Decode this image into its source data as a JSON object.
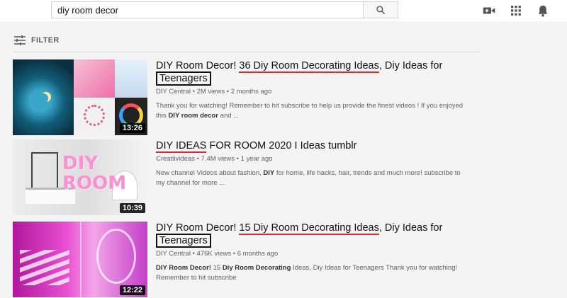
{
  "search": {
    "query": "diy room decor",
    "icon": "search-icon"
  },
  "header_icons": [
    "video-camera-icon",
    "apps-grid-icon",
    "bell-icon"
  ],
  "filter": {
    "label": "FILTER",
    "icon": "filter-sliders-icon"
  },
  "results": [
    {
      "title_parts": [
        "DIY Room Decor! ",
        "36 Diy Room Decorating Ideas",
        ", Diy Ideas for ",
        "Teenagers"
      ],
      "channel": "DIY Central",
      "views": "2M views",
      "age": "2 months ago",
      "description_parts": [
        "Thank you for watching! Remember to hit subscribe to help us provide the finest videos ! If you enjoyed this ",
        "DIY room decor",
        " and ..."
      ],
      "duration": "13:26"
    },
    {
      "title_parts": [
        "DIY IDEAS",
        " FOR ROOM 2020 I Ideas tumblr"
      ],
      "channel": "Creatiivideas",
      "views": "7.4M views",
      "age": "1 year ago",
      "description_parts": [
        "New channel Videos about fashion, ",
        "DIY",
        " for home, life hacks, hair, trends and much more! subscribe to my channel for more ..."
      ],
      "duration": "10:39",
      "thumb_text_1": "DIY",
      "thumb_text_2": "ROOM"
    },
    {
      "title_parts": [
        "DIY Room Decor! ",
        "15 Diy Room Decorating Ideas",
        ", Diy Ideas for ",
        "Teenagers"
      ],
      "channel": "DIY Central",
      "views": "476K views",
      "age": "6 months ago",
      "description_parts": [
        "DIY Room Decor!",
        " 15 ",
        "Diy Room Decorating",
        " Ideas, Diy Ideas for Teenagers Thank you for watching! Remember to hit subscribe"
      ],
      "duration": "12:22"
    }
  ],
  "colors": {
    "underline": "#d62b2b",
    "box": "#111111",
    "meta_text": "#606060"
  }
}
